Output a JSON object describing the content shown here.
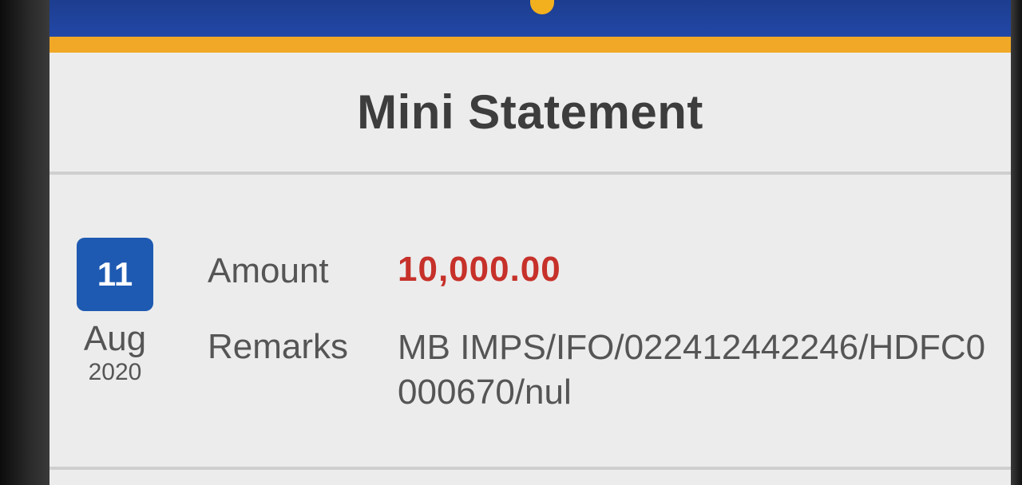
{
  "statement": {
    "title": "Mini Statement"
  },
  "transaction": {
    "day": "11",
    "month": "Aug",
    "year": "2020",
    "amount_label": "Amount",
    "amount_value": "10,000.00",
    "remarks_label": "Remarks",
    "remarks_value": "MB IMPS/IFO/022412442246/HDFC0000670/nul"
  },
  "colors": {
    "header_blue": "#1d3d8f",
    "accent_orange": "#f0a826",
    "date_badge_blue": "#1e5ab2",
    "amount_red": "#c6312a"
  }
}
